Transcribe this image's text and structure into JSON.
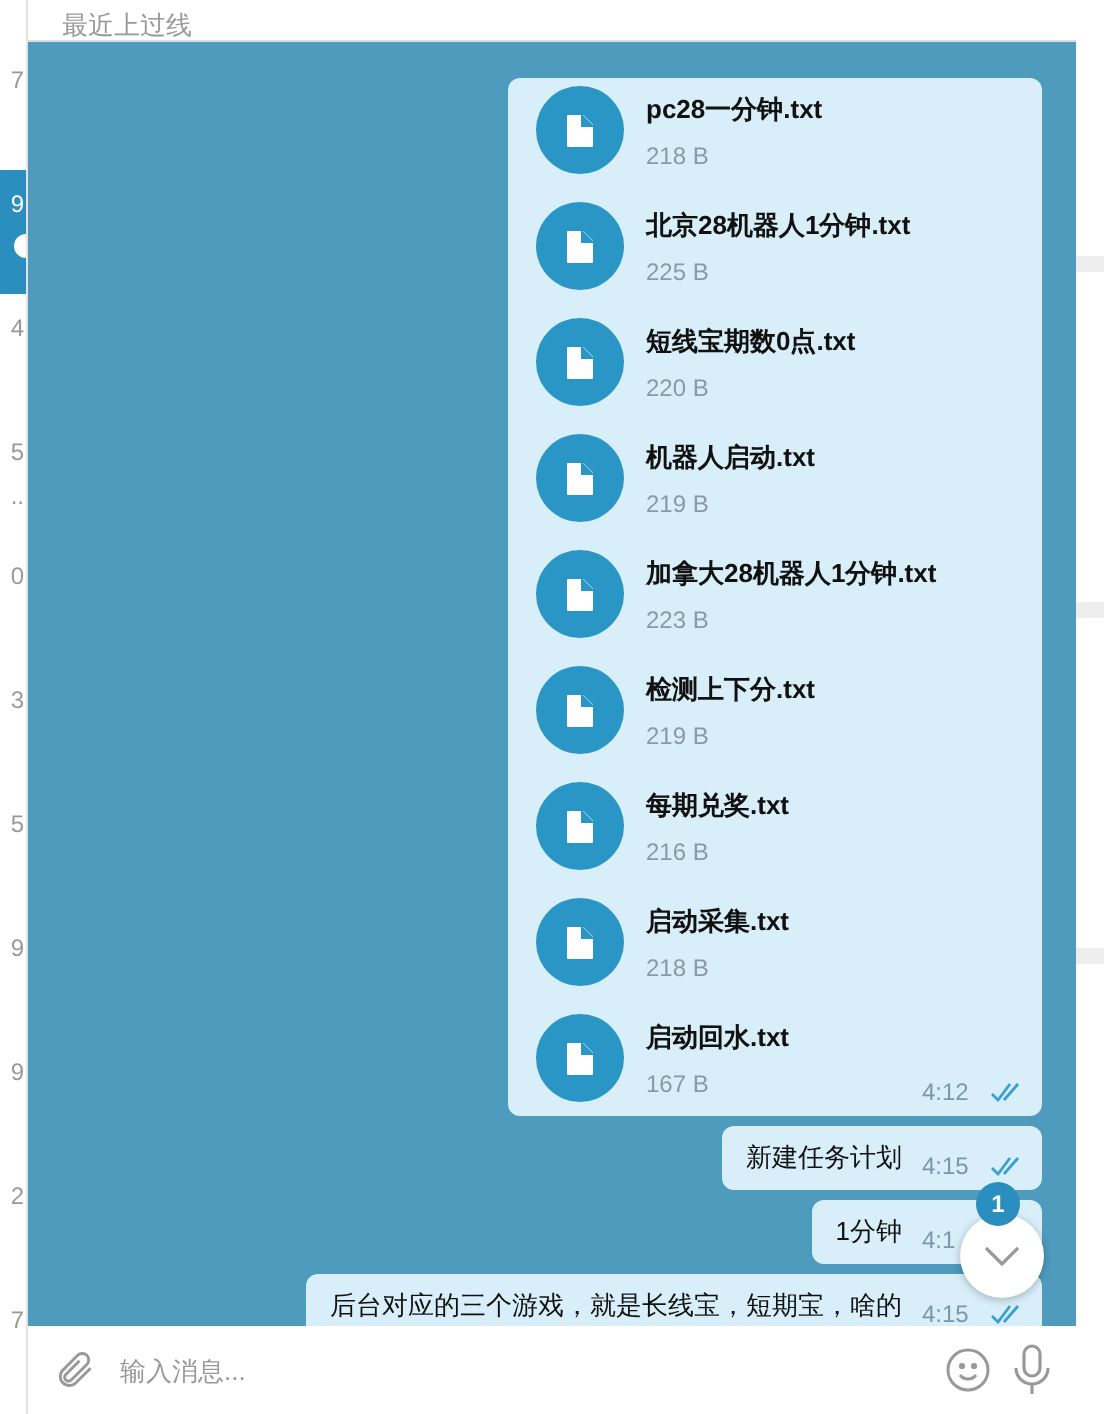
{
  "chat_list": [
    {
      "time": "7",
      "selected": false
    },
    {
      "time": "9",
      "selected": true,
      "unread": true
    },
    {
      "time": "4",
      "selected": false
    },
    {
      "time": "5",
      "preview": "..",
      "selected": false
    },
    {
      "time": "0",
      "selected": false
    },
    {
      "time": "3",
      "selected": false
    },
    {
      "time": "5",
      "selected": false
    },
    {
      "time": "9",
      "selected": false
    },
    {
      "time": "9",
      "selected": false
    },
    {
      "time": "2",
      "selected": false
    },
    {
      "time": "7",
      "selected": false
    }
  ],
  "header": {
    "status": "最近上过线"
  },
  "messages": [
    {
      "kind": "files",
      "time": "4:12",
      "read": true,
      "files": [
        {
          "name": "pc28一分钟.txt",
          "size": "218 B"
        },
        {
          "name": "北京28机器人1分钟.txt",
          "size": "225 B"
        },
        {
          "name": "短线宝期数0点.txt",
          "size": "220 B"
        },
        {
          "name": "机器人启动.txt",
          "size": "219 B"
        },
        {
          "name": "加拿大28机器人1分钟.txt",
          "size": "223 B"
        },
        {
          "name": "检测上下分.txt",
          "size": "219 B"
        },
        {
          "name": "每期兑奖.txt",
          "size": "216 B"
        },
        {
          "name": "启动采集.txt",
          "size": "218 B"
        },
        {
          "name": "启动回水.txt",
          "size": "167 B"
        }
      ]
    },
    {
      "kind": "text",
      "text": "新建任务计划",
      "time": "4:15",
      "read": true
    },
    {
      "kind": "text",
      "text": "1分钟",
      "time": "4:1"
    },
    {
      "kind": "text",
      "text": "后台对应的三个游戏，就是长线宝，短期宝，啥的",
      "time": "4:15",
      "read": true
    }
  ],
  "scroll_down": {
    "badge": "1"
  },
  "composer": {
    "placeholder": "输入消息..."
  }
}
